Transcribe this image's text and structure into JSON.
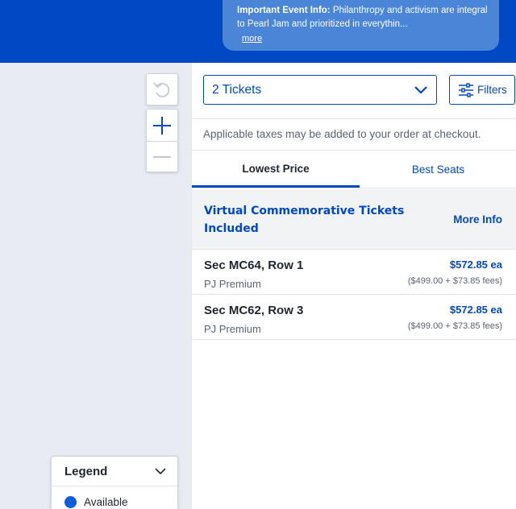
{
  "banner": {
    "bold_text": "Important Event Info:",
    "text": " Philanthropy and activism are integral to Pearl Jam and prioritized in everythin...",
    "more_link": "more"
  },
  "map": {
    "legend": {
      "title": "Legend",
      "items": [
        {
          "label": "Available",
          "color": "#0d5fd9"
        }
      ]
    }
  },
  "controls": {
    "quantity": "2 Tickets",
    "filters_label": "Filters"
  },
  "notice": "Applicable taxes may be added to your order at checkout.",
  "tabs": [
    {
      "label": "Lowest Price",
      "active": true
    },
    {
      "label": "Best Seats",
      "active": false
    }
  ],
  "promo": {
    "title": "Virtual Commemorative Tickets Included",
    "link": "More Info"
  },
  "tickets": [
    {
      "section": "Sec MC64, Row 1",
      "type": "PJ Premium",
      "price": "$572.85 ea",
      "breakdown": "($499.00 + $73.85 fees)"
    },
    {
      "section": "Sec MC62, Row 3",
      "type": "PJ Premium",
      "price": "$572.85 ea",
      "breakdown": "($499.00 + $73.85 fees)"
    }
  ],
  "colors": {
    "brand": "#0148c4",
    "banner": "#4b85d8",
    "map_bg": "#e8ebf2"
  }
}
